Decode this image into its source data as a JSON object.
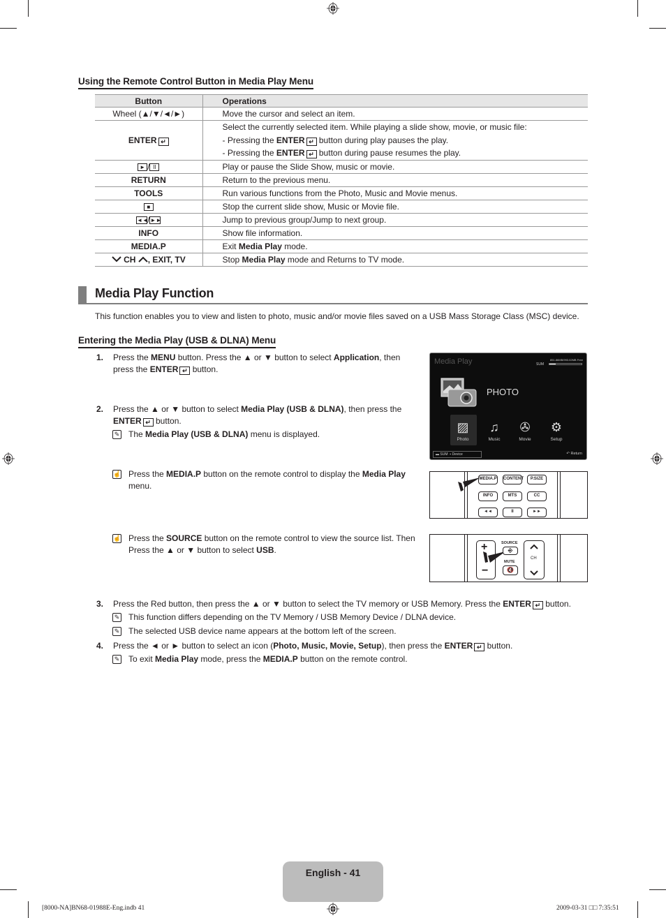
{
  "section_remote": {
    "heading": "Using the Remote Control Button in Media Play Menu",
    "table": {
      "headers": [
        "Button",
        "Operations"
      ],
      "rows": [
        {
          "button": "Wheel (▲/▼/◄/►)",
          "button_bold": false,
          "ops": [
            "Move the cursor and select an item."
          ]
        },
        {
          "button": "ENTER",
          "button_bold": true,
          "button_icon": "enter-icon",
          "ops": [
            "Select the currently selected item. While playing a slide show, movie, or music file:",
            "- Pressing the ENTER button during play pauses the play.",
            "- Pressing the ENTER button during pause resumes the play."
          ]
        },
        {
          "button": "►/II",
          "button_icon": "play-pause-icon",
          "ops": [
            "Play or pause the Slide Show, music or movie."
          ]
        },
        {
          "button": "RETURN",
          "button_bold": true,
          "ops": [
            "Return to the previous menu."
          ]
        },
        {
          "button": "TOOLS",
          "button_bold": true,
          "ops": [
            "Run various functions from the Photo, Music and Movie menus."
          ]
        },
        {
          "button": "■",
          "button_icon": "stop-icon",
          "ops": [
            "Stop the current slide show, Music or Movie file."
          ]
        },
        {
          "button": "◄◄/►►",
          "button_icon": "rewind-forward-icon",
          "ops": [
            "Jump to previous group/Jump to next group."
          ]
        },
        {
          "button": "INFO",
          "button_bold": true,
          "ops": [
            "Show file information."
          ]
        },
        {
          "button": "MEDIA.P",
          "button_bold": true,
          "ops": [
            "Exit Media Play mode."
          ]
        },
        {
          "button": "CH, EXIT, TV",
          "button_bold": true,
          "ops": [
            "Stop Media Play mode and Returns to TV mode."
          ]
        }
      ]
    },
    "enter_row": {
      "line1": "Select the currently selected item. While playing a slide show, movie, or music file:",
      "line2_pre": "- Pressing the ",
      "line2_bold": "ENTER",
      "line2_post": " button during play pauses the play.",
      "line3_pre": "- Pressing the ",
      "line3_bold": "ENTER",
      "line3_post": " button during pause resumes the play."
    },
    "mediap_row": {
      "pre": "Exit ",
      "bold": "Media Play",
      "post": " mode."
    },
    "ch_row": {
      "button_mid": " CH ",
      "button_tail": ", EXIT, TV",
      "pre": "Stop ",
      "bold": "Media Play",
      "post": " mode and Returns to TV mode."
    },
    "wheel_label": "Wheel (▲/▼/◄/►)",
    "enter_label": "ENTER"
  },
  "section_media_play": {
    "heading": "Media Play Function",
    "intro": "This function enables you to view and listen to photo, music and/or movie files saved on a USB Mass Storage Class (MSC) device.",
    "subheading": "Entering the Media Play (USB & DLNA) Menu",
    "steps": [
      {
        "num": "1.",
        "parts": [
          "Press the ",
          "MENU",
          " button. Press the ▲ or ▼ button to select ",
          "Application",
          ", then press the ",
          "ENTER",
          " button."
        ]
      },
      {
        "num": "2.",
        "parts": [
          "Press the ▲ or ▼ button to select ",
          "Media Play (USB & DLNA)",
          ", then press the ",
          "ENTER",
          " button."
        ],
        "note": [
          "The ",
          "Media Play (USB & DLNA)",
          " menu is displayed."
        ]
      },
      {
        "num": "3.",
        "parts": [
          "Press the Red button, then press the ▲ or ▼ button to select the TV memory or USB Memory. Press the ",
          "ENTER",
          " button."
        ],
        "notes": [
          "This function differs depending on the TV Memory / USB Memory Device / DLNA device.",
          "The selected USB device name appears at the bottom left of the screen."
        ]
      },
      {
        "num": "4.",
        "parts": [
          "Press the ◄ or ► button to select an icon (",
          "Photo, Music, Movie, Setup",
          "), then press the ",
          "ENTER",
          " button."
        ],
        "note": [
          "To exit ",
          "Media Play",
          " mode, press the ",
          "MEDIA.P",
          " button on the remote control."
        ]
      }
    ],
    "remote_notes": [
      {
        "parts": [
          "Press the ",
          "MEDIA.P",
          " button on the remote control to display the ",
          "Media Play",
          " menu."
        ]
      },
      {
        "parts": [
          "Press the ",
          "SOURCE",
          " button on the remote control to view the source list. Then Press the ▲ or ▼ button to select ",
          "USB",
          "."
        ]
      }
    ]
  },
  "tv_screen": {
    "title": "Media Play",
    "device": "SUM",
    "storage_text": "851.86MB/993.02MB Free",
    "storage_used_fraction": 0.2,
    "selected_label": "PHOTO",
    "items": [
      "Photo",
      "Music",
      "Movie",
      "Setup"
    ],
    "footer_device": "SUM",
    "footer_device_label": "Device",
    "footer_return": "Return"
  },
  "remote_panel_1": {
    "buttons_row1": [
      "MEDIA.P",
      "CONTENT",
      "P.SIZE"
    ],
    "buttons_row2": [
      "INFO",
      "MTS",
      "CC"
    ],
    "buttons_row3": [
      "◄◄",
      "II",
      "►►"
    ]
  },
  "remote_panel_2": {
    "source_label": "SOURCE",
    "mute_label": "MUTE",
    "ch_label": "CH"
  },
  "footer": {
    "page_label": "English - 41",
    "slug_left": "[8000-NA]BN68-01988E-Eng.indb   41",
    "slug_right": "2009-03-31   □□ 7:35:51"
  }
}
